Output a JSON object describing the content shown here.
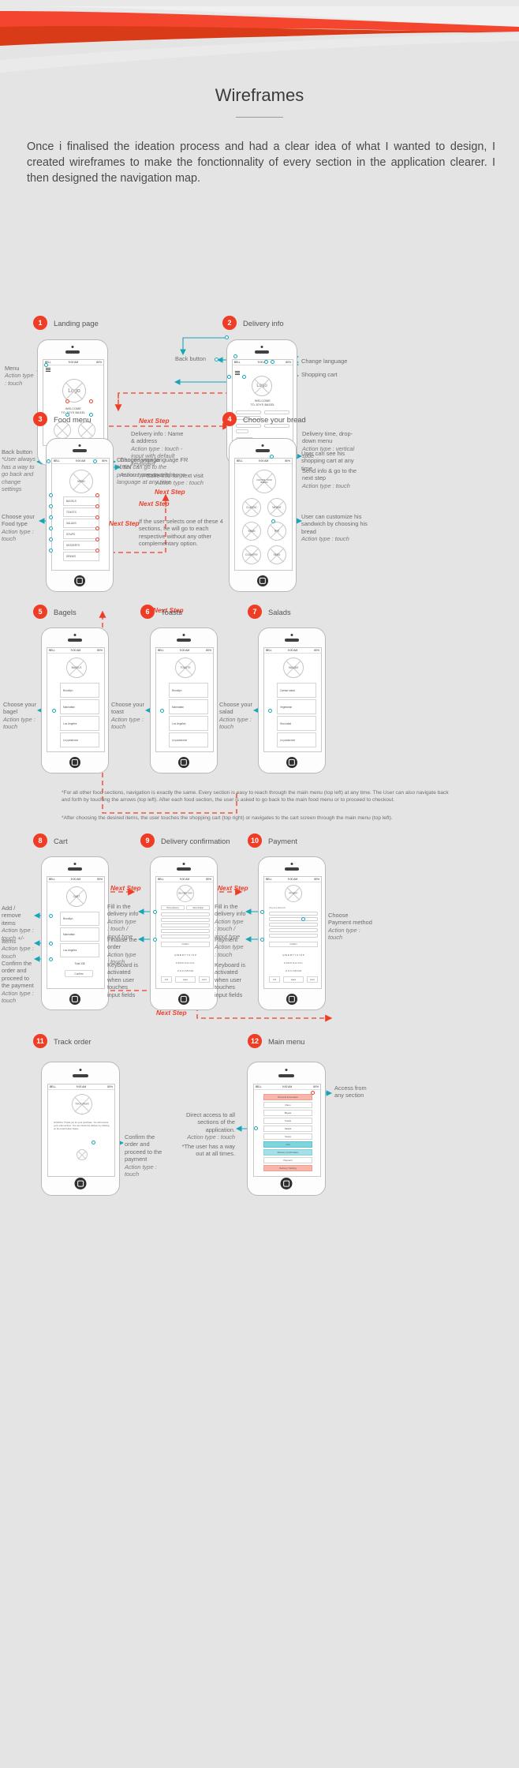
{
  "header": {
    "title": "Wireframes",
    "intro": "Once i finalised the ideation process and had a clear idea of what I wanted to design, I created wireframes to make the fonctionnality of every section in the application clearer. I then designed the navigation map.",
    "accent_red": "#ef3c25",
    "accent_dark_red": "#d93b18",
    "accent_teal": "#17a5b8",
    "background": "#e4e4e4"
  },
  "labels": {
    "next_step": "Next Step",
    "welcome_line1": "WELCOME",
    "welcome_line2": "TO JOYS BAGEL",
    "logo": "Logo",
    "status_carrier": "BELL",
    "status_time": "9:00 AM",
    "status_battery": "80%"
  },
  "sections": [
    {
      "num": "1",
      "title": "Landing page"
    },
    {
      "num": "2",
      "title": "Delivery info"
    },
    {
      "num": "3",
      "title": "Food menu"
    },
    {
      "num": "4",
      "title": "Choose your bread"
    },
    {
      "num": "5",
      "title": "Bagels"
    },
    {
      "num": "6",
      "title": "Toasts"
    },
    {
      "num": "7",
      "title": "Salads"
    },
    {
      "num": "8",
      "title": "Cart"
    },
    {
      "num": "9",
      "title": "Delivery confirmation"
    },
    {
      "num": "10",
      "title": "Payment"
    },
    {
      "num": "11",
      "title": "Track order"
    },
    {
      "num": "12",
      "title": "Main menu"
    }
  ],
  "annotations": {
    "menu": {
      "text": "Menu",
      "action": "Action type : touch"
    },
    "choose_language": {
      "text": "Choose your language FR / EN",
      "action": "Action type : touch"
    },
    "back_button": {
      "text": "Back button"
    },
    "change_language": {
      "text": "Change language"
    },
    "shopping_cart": {
      "text": "Shopping cart"
    },
    "delivery_info": {
      "text": "Delivery info : Name & address",
      "action": "Action type : touch - input with default keyboard"
    },
    "delivery_time": {
      "text": "Delivery time, drop-down menu",
      "action": "Action type : vertical slide"
    },
    "save_info": {
      "text": "Save info for next visit",
      "action": "Action type : touch"
    },
    "send_info": {
      "text": "Send info & go to the next step",
      "action": "Action type : touch"
    },
    "back_button_3": {
      "text": "Back button",
      "sub": "*User always has a way to go back and change settings",
      "action": "Action type : touch"
    },
    "choose_food": {
      "text": "Choose your Food type",
      "action": "Action type : touch"
    },
    "change_language_3": {
      "text": "Change langage",
      "sub": "*User can go to the previous screen or change language at any time"
    },
    "four_sections": {
      "text": "If the user selects one of these 4 sections, he will go to each respective without any other complementary option."
    },
    "cart_any_time": {
      "text": "User can see his shopping cart at any time"
    },
    "customize": {
      "text": "User can customize his sandwich by choosing his bread",
      "action": "Action type : touch"
    },
    "choose_bagel": {
      "text": "Choose your bagel",
      "action": "Action type : touch"
    },
    "choose_toast": {
      "text": "Choose your toast",
      "action": "Action type : touch"
    },
    "choose_salad": {
      "text": "Choose your salad",
      "action": "Action type : touch"
    },
    "add_remove": {
      "text": "Add / remove items",
      "action": "Action type : touch +/-"
    },
    "confirm_order": {
      "text": "Confirm the order and proceed to the payment",
      "action": "Action type : touch"
    },
    "fill_delivery": {
      "text": "Fill in the delivery info",
      "action": "Action type : touch / input type"
    },
    "finalise_order": {
      "text": "Finalise the order",
      "action": "Action type : touch"
    },
    "keyboard_activated": {
      "text": "Keyboard is activated when user touches input fields"
    },
    "fill_delivery_10": {
      "text": "Fill in the delivery info",
      "action": "Action type : touch / input type"
    },
    "payment_10": {
      "text": "Payment",
      "action": "Action type : touch"
    },
    "choose_payment": {
      "text": "Choose Payment method",
      "action": "Action type : touch"
    },
    "confirm_payment_11": {
      "text": "Confirm the order and proceed to the payment",
      "action": "Action type : touch"
    },
    "direct_access": {
      "text": "Direct access to all sections of the application.",
      "action": "Action type : touch"
    },
    "way_out": {
      "text": "*The user has a way out at all times."
    },
    "access_any": {
      "text": "Access from any section"
    }
  },
  "footnotes": [
    "*For all other food sections, navigation is exactly the same. Every section is easy to reach through the main menu (top left) at any time. The User can also navigate back and forth by touching the arrows (top left). After each food section, the user is asked to go back to the main food menu or to proceed to checkout.",
    "*After choosing the desired items, the user touches the shopping cart (top right) or navigates to the cart screen through the main menu (top left)."
  ],
  "menus": {
    "food_menu_title": "MENU",
    "food_items": [
      "BAGELS",
      "TOASTS",
      "SALADS",
      "SOUPS",
      "DESSERTS",
      "DRINKS"
    ],
    "bread_title": "CHOOSE YOUR BREAD",
    "bread_items": [
      "CLASSIC",
      "WHEAT",
      "BRAN",
      "RYE",
      "COUNTRY",
      "SEED"
    ],
    "bagels_title": "BAGELS",
    "bagel_items": [
      "Brooklyn",
      "Manhattan",
      "Los Angeles",
      "Le parisienne"
    ],
    "toasts_title": "TOASTS",
    "toast_items": [
      "Brooklyn",
      "Manhattan",
      "Los Angeles",
      "Le parisienne"
    ],
    "salads_title": "SALADS",
    "salad_items": [
      "Caesar salad",
      "Vegetarian",
      "Sea salad",
      "Le parisienne"
    ],
    "cart_title": "CART",
    "cart_items": [
      "Brooklyn",
      "Manhattan",
      "Los Angeles"
    ],
    "cart_total": "Total  33$",
    "cart_button": "Confirm",
    "confirm_title": "DELIVERY INFO",
    "payment_title": "PAYMENT",
    "payment_label": "Payment Methods",
    "track_title": "TRACK ORDER",
    "track_body": "Hi Michel, Thank you for your purchase. You will receive your order at 6pm. You can check the delivery by clicking on the track button below.",
    "main_menu_title": "MAIN MENU",
    "main_menu_items": [
      "Personal Information",
      "Menu",
      "Bagels",
      "Toasts",
      "Salads",
      "Soups",
      "Cart",
      "Delivery Confirmation",
      "Payment",
      "Delivery Tracking"
    ],
    "tabs": [
      "Home Delivery",
      "Store Pickup"
    ],
    "keyboard_rows": [
      "Q W E R T Y U I O P",
      "A S D F G H J K L",
      "Z X C V B N M"
    ],
    "keyboard_bottom": [
      "123",
      "space",
      "return"
    ]
  }
}
